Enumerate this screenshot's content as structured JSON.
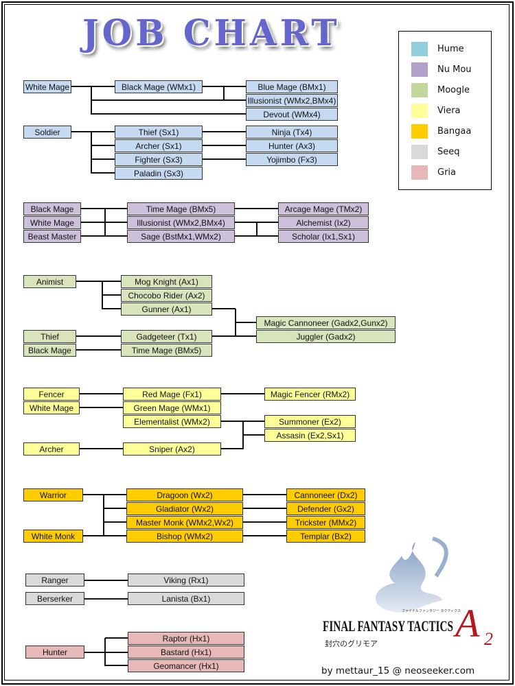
{
  "title": "JOB CHART",
  "legend": [
    {
      "label": "Hume",
      "color": "#92cddc"
    },
    {
      "label": "Nu Mou",
      "color": "#b1a0c7"
    },
    {
      "label": "Moogle",
      "color": "#c4d79b"
    },
    {
      "label": "Viera",
      "color": "#ffff99"
    },
    {
      "label": "Bangaa",
      "color": "#ffcc00"
    },
    {
      "label": "Seeq",
      "color": "#d9d9d9"
    },
    {
      "label": "Gria",
      "color": "#e6b8b7"
    }
  ],
  "box_colors": {
    "hume": "#c5d9f1",
    "numou": "#ccc0da",
    "moogle": "#d8e4bc",
    "viera": "#ffff99",
    "bangaa": "#ffcc00",
    "seeq": "#d9d9d9",
    "gria": "#e6b8b7"
  },
  "groups": {
    "hume": {
      "base1": [
        "White Mage"
      ],
      "tier1a": [
        "Black Mage (WMx1)"
      ],
      "tier2a": [
        "Blue Mage (BMx1)",
        "Illusionist (WMx2,BMx4)",
        "Devout (WMx4)"
      ],
      "base2": [
        "Soldier"
      ],
      "tier1b": [
        "Thief (Sx1)",
        "Archer (Sx1)",
        "Fighter (Sx3)",
        "Paladin (Sx3)"
      ],
      "tier2b": [
        "Ninja (Tx4)",
        "Hunter (Ax3)",
        "Yojimbo (Fx3)"
      ]
    },
    "numou": {
      "base": [
        "Black Mage",
        "White Mage",
        "Beast Master"
      ],
      "tier1": [
        "Time Mage (BMx5)",
        "Illusionist (WMx2,BMx4)",
        "Sage (BstMx1,WMx2)"
      ],
      "tier2": [
        "Arcage Mage (TMx2)",
        "Alchemist (Ix2)",
        "Scholar (Ix1,Sx1)"
      ]
    },
    "moogle": {
      "base1": [
        "Animist"
      ],
      "tier1a": [
        "Mog Knight (Ax1)",
        "Chocobo Rider (Ax2)",
        "Gunner (Ax1)"
      ],
      "base2": [
        "Thief",
        "Black Mage"
      ],
      "tier1b": [
        "Gadgeteer (Tx1)",
        "Time Mage (BMx5)"
      ],
      "tier2": [
        "Magic Cannoneer (Gadx2,Gunx2)",
        "Juggler (Gadx2)"
      ]
    },
    "viera": {
      "base1": [
        "Fencer",
        "White Mage"
      ],
      "tier1a": [
        "Red Mage (Fx1)",
        "Green Mage (WMx1)",
        "Elementalist (WMx2)"
      ],
      "tier2a": [
        "Magic Fencer (RMx2)"
      ],
      "tier2b": [
        "Summoner (Ex2)",
        "Assasin (Ex2,Sx1)"
      ],
      "base2": [
        "Archer"
      ],
      "tier1b": [
        "Sniper (Ax2)"
      ]
    },
    "bangaa": {
      "base1": [
        "Warrior"
      ],
      "base2": [
        "White Monk"
      ],
      "tier1": [
        "Dragoon (Wx2)",
        "Gladiator (Wx2)",
        "Master Monk (WMx2,Wx2)",
        "Bishop (WMx2)"
      ],
      "tier2": [
        "Cannoneer (Dx2)",
        "Defender (Gx2)",
        "Trickster (MMx2)",
        "Templar (Bx2)"
      ]
    },
    "seeq": {
      "base": [
        "Ranger",
        "Berserker"
      ],
      "tier1": [
        "Viking (Rx1)",
        "Lanista (Bx1)"
      ]
    },
    "gria": {
      "base": [
        "Hunter"
      ],
      "tier1": [
        "Raptor (Hx1)",
        "Bastard (Hx1)",
        "Geomancer (Hx1)"
      ]
    }
  },
  "logo": {
    "title": "FINAL FANTASY TACTICS",
    "suffix": "A",
    "suffix_sub": "2",
    "subtitle_jp": "封穴のグリモア",
    "kana": "ファイナルファンタジー タクティクス"
  },
  "credit": "by mettaur_15 @ neoseeker.com"
}
